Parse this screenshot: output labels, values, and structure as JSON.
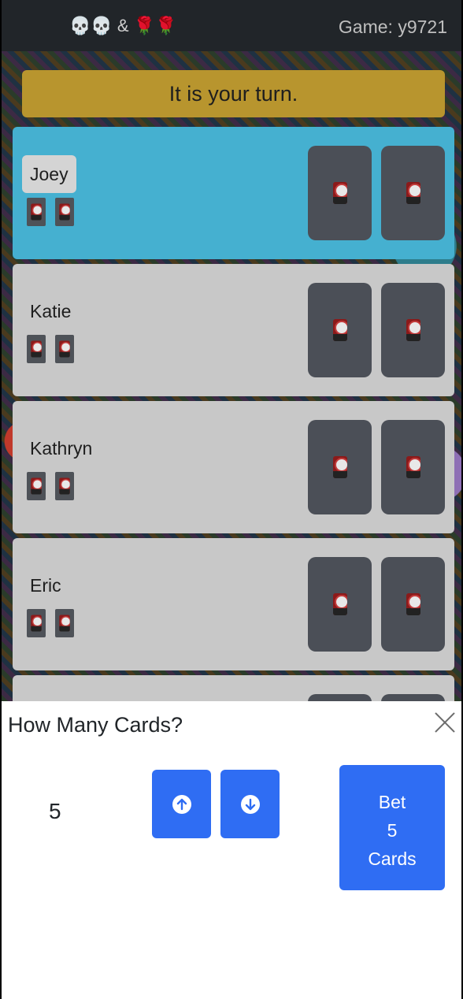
{
  "header": {
    "brand": "💀💀 & 🌹🌹",
    "game_id": "Game: y9721"
  },
  "banner": {
    "text": "It is your turn."
  },
  "players": [
    {
      "name": "Joey"
    },
    {
      "name": "Katie"
    },
    {
      "name": "Kathryn"
    },
    {
      "name": "Eric"
    }
  ],
  "bet_sheet": {
    "title": "How Many Cards?",
    "count": "5",
    "bet_line1": "Bet",
    "bet_line2": "5",
    "bet_line3": "Cards"
  },
  "icons": [
    "skull-icon",
    "rose-icon",
    "card-back-icon",
    "arrow-up-circle-icon",
    "arrow-down-circle-icon",
    "close-icon"
  ],
  "colors": {
    "active_player": "#45b0d0",
    "banner": "#b8952e",
    "primary_button": "#2f6df3"
  }
}
